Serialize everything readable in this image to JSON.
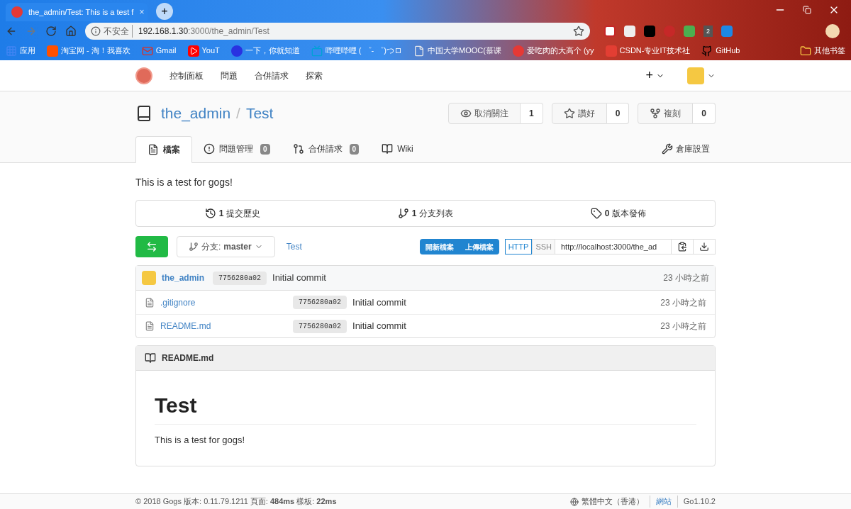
{
  "browser": {
    "tab_title": "the_admin/Test: This is a test f",
    "tab_close": "×",
    "new_tab": "+",
    "security": "不安全",
    "url_host": "192.168.1.30",
    "url_path": ":3000/the_admin/Test",
    "bookmarks": [
      {
        "label": "应用",
        "kind": "apps"
      },
      {
        "label": "淘宝网 - 淘！我喜欢",
        "kind": "taobao"
      },
      {
        "label": "Gmail",
        "kind": "gmail"
      },
      {
        "label": "YouT",
        "kind": "youtube"
      },
      {
        "label": "一下，你就知道",
        "kind": "baidu"
      },
      {
        "label": "哔哩哔哩 ( ゜- ゜)つロ",
        "kind": "bilibili"
      },
      {
        "label": "中国大学MOOC(慕课",
        "kind": "page"
      },
      {
        "label": "爱吃肉的大高个 (yy",
        "kind": "gogs"
      },
      {
        "label": "CSDN-专业IT技术社",
        "kind": "csdn"
      },
      {
        "label": "GitHub",
        "kind": "github"
      }
    ],
    "other_bookmarks": "其他书签",
    "ext_badge": "2"
  },
  "nav": {
    "items": [
      "控制面板",
      "問題",
      "合併請求",
      "探索"
    ],
    "plus": "+"
  },
  "repo": {
    "owner": "the_admin",
    "separator": "/",
    "name": "Test",
    "actions": [
      {
        "label": "取消關注",
        "count": "1",
        "kind": "watch"
      },
      {
        "label": "讚好",
        "count": "0",
        "kind": "star"
      },
      {
        "label": "複刻",
        "count": "0",
        "kind": "fork"
      }
    ],
    "tabs": [
      {
        "label": "檔案",
        "kind": "code",
        "selected": true
      },
      {
        "label": "問題管理",
        "count": "0",
        "kind": "issues",
        "selected": false
      },
      {
        "label": "合併請求",
        "count": "0",
        "kind": "pulls",
        "selected": false
      },
      {
        "label": "Wiki",
        "kind": "wiki",
        "selected": false
      }
    ],
    "settings": "倉庫設置",
    "description": "This is a test for gogs!"
  },
  "stats": [
    {
      "count": "1",
      "label": "提交歷史",
      "kind": "history"
    },
    {
      "count": "1",
      "label": "分支列表",
      "kind": "branch"
    },
    {
      "count": "0",
      "label": "版本發佈",
      "kind": "tag"
    }
  ],
  "toolbar": {
    "branch_prefix": "分支:",
    "branch": "master",
    "path": "Test",
    "new_file": "開新檔案",
    "upload": "上傳檔案",
    "protocols": [
      {
        "label": "HTTP",
        "selected": true
      },
      {
        "label": "SSH",
        "selected": false
      }
    ],
    "clone_url": "http://localhost:3000/the_ad"
  },
  "latest_commit": {
    "author": "the_admin",
    "sha": "7756280a02",
    "message": "Initial commit",
    "time": "23 小時之前"
  },
  "files": [
    {
      "name": ".gitignore",
      "sha": "7756280a02",
      "message": "Initial commit",
      "time": "23 小時之前"
    },
    {
      "name": "README.md",
      "sha": "7756280a02",
      "message": "Initial commit",
      "time": "23 小時之前"
    }
  ],
  "readme": {
    "filename": "README.md",
    "heading": "Test",
    "body": "This is a test for gogs!"
  },
  "footer": {
    "left": "© 2018 Gogs 版本: 0.11.79.1211 頁面: **484ms** 樣板: **22ms**",
    "language": "繁體中文（香港）",
    "links": [
      "網站",
      "Go1.10.2"
    ]
  }
}
